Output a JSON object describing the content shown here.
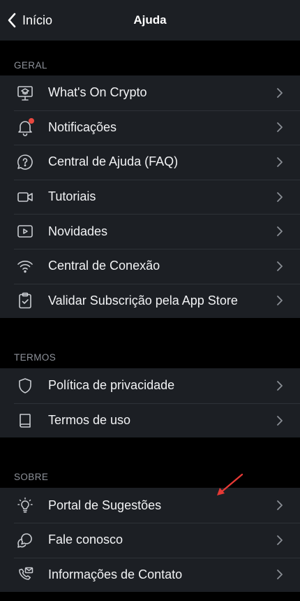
{
  "header": {
    "back_label": "Início",
    "title": "Ajuda"
  },
  "sections": [
    {
      "title": "GERAL",
      "items": [
        {
          "label": "What's On Crypto",
          "icon": "presentation-board-icon"
        },
        {
          "label": "Notificações",
          "icon": "bell-icon",
          "badge_color": "#e8483f"
        },
        {
          "label": "Central de Ajuda (FAQ)",
          "icon": "help-bubble-icon"
        },
        {
          "label": "Tutoriais",
          "icon": "video-camera-icon"
        },
        {
          "label": "Novidades",
          "icon": "play-screen-icon"
        },
        {
          "label": "Central de Conexão",
          "icon": "wifi-icon"
        },
        {
          "label": "Validar Subscrição pela App Store",
          "icon": "clipboard-check-icon"
        }
      ]
    },
    {
      "title": "TERMOS",
      "items": [
        {
          "label": "Política de privacidade",
          "icon": "shield-icon"
        },
        {
          "label": "Termos de uso",
          "icon": "book-icon"
        }
      ]
    },
    {
      "title": "SOBRE",
      "items": [
        {
          "label": "Portal de Sugestões",
          "icon": "lightbulb-icon"
        },
        {
          "label": "Fale conosco",
          "icon": "chat-bubbles-icon"
        },
        {
          "label": "Informações de Contato",
          "icon": "phone-mail-icon"
        }
      ]
    }
  ],
  "colors": {
    "background": "#000000",
    "surface": "#1c1f24",
    "text": "#f2f3f5",
    "section_header": "#8e929a",
    "icon": "#c9ccd1",
    "chevron": "#8a8e95",
    "annotation_arrow": "#e53935"
  },
  "annotation": {
    "icon": "red-arrow-icon"
  }
}
